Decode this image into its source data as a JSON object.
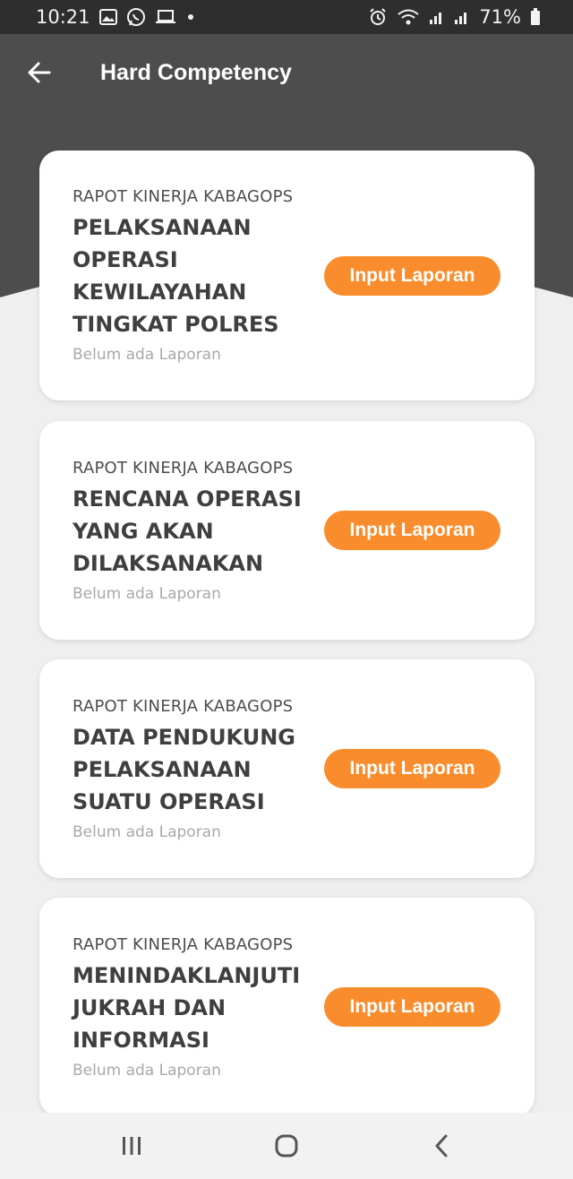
{
  "status_bar": {
    "time": "10:21",
    "left_icons": [
      "image-icon",
      "whatsapp-icon",
      "laptop-icon",
      "dot-icon"
    ],
    "right_icons": [
      "alarm-icon",
      "wifi-icon",
      "signal-icon",
      "signal-icon"
    ],
    "battery": "71%"
  },
  "header": {
    "title": "Hard Competency",
    "back_icon": "arrow-left-icon",
    "background_color": "#4d4d4d"
  },
  "cards": [
    {
      "category": "RAPOT KINERJA KABAGOPS",
      "title": "PELAKSANAAN OPERASI KEWILAYAHAN TINGKAT POLRES",
      "status": "Belum ada Laporan",
      "button_label": "Input Laporan"
    },
    {
      "category": "RAPOT KINERJA KABAGOPS",
      "title": "RENCANA OPERASI YANG AKAN DILAKSANAKAN",
      "status": "Belum ada Laporan",
      "button_label": "Input Laporan"
    },
    {
      "category": "RAPOT KINERJA KABAGOPS",
      "title": "DATA PENDUKUNG PELAKSANAAN SUATU OPERASI",
      "status": "Belum ada Laporan",
      "button_label": "Input Laporan"
    },
    {
      "category": "RAPOT KINERJA KABAGOPS",
      "title": "MENINDAKLANJUTI JUKRAH DAN INFORMASI",
      "status": "Belum ada Laporan",
      "button_label": "Input Laporan"
    }
  ],
  "accent_color": "#f98d2d",
  "nav_bar": {
    "icons": [
      "recent-apps-icon",
      "home-icon",
      "back-icon"
    ]
  }
}
